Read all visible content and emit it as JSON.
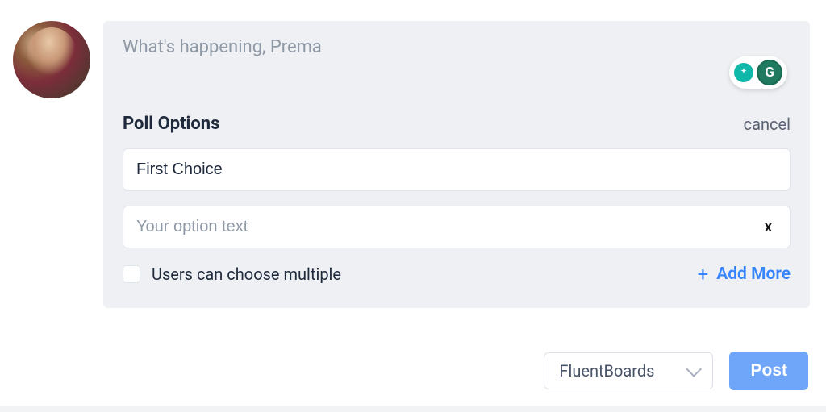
{
  "composer": {
    "placeholder": "What's happening, Prema"
  },
  "extensions": {
    "bulb_name": "sparkle-icon",
    "grammarly_letter": "G"
  },
  "poll": {
    "title": "Poll Options",
    "cancel_label": "cancel",
    "options": [
      {
        "value": "First Choice",
        "placeholder": ""
      },
      {
        "value": "",
        "placeholder": "Your option text"
      }
    ],
    "remove_glyph": "x",
    "multi_label": "Users can choose multiple",
    "add_more_label": "Add More",
    "add_more_glyph": "+"
  },
  "footer": {
    "select_value": "FluentBoards",
    "post_label": "Post"
  }
}
